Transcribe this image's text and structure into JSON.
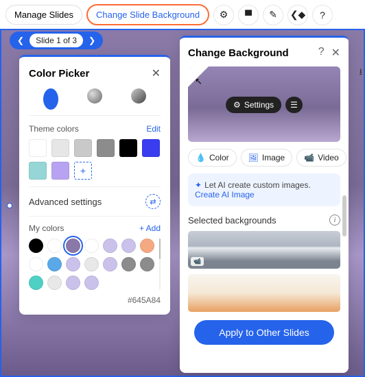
{
  "toolbar": {
    "manage_slides": "Manage Slides",
    "change_bg": "Change Slide Background"
  },
  "slide_nav": {
    "label": "Slide 1 of 3"
  },
  "color_picker": {
    "title": "Color Picker",
    "theme_label": "Theme colors",
    "edit": "Edit",
    "theme_swatches": [
      "#ffffff",
      "#e6e6e6",
      "#c9c9c9",
      "#8c8c8c",
      "#000000",
      "#3a3cf0",
      "#96d6d6",
      "#b8a3f2"
    ],
    "advanced": "Advanced settings",
    "my_label": "My colors",
    "add": "+ Add",
    "my_swatches": [
      "#000000",
      "#ffffff",
      "#8a79a8",
      "#ffffff",
      "#cbc2ec",
      "#cbc2ec",
      "#f5a983",
      "#ffffff",
      "#5aa8e8",
      "#cbc2ec",
      "#e8e8e8",
      "#cbc2ec",
      "#8c8c8c",
      "#8c8c8c",
      "#4ed0c5",
      "#e8e8e8",
      "#cbc2ec",
      "#cbc2ec"
    ],
    "selected_index": 2,
    "hex": "#645A84"
  },
  "bg_panel": {
    "title": "Change Background",
    "settings": "Settings",
    "color": "Color",
    "image": "Image",
    "video": "Video",
    "ai_text": "Let AI create custom images. ",
    "ai_link": "Create AI Image",
    "selected": "Selected backgrounds",
    "apply": "Apply to Other Slides"
  }
}
